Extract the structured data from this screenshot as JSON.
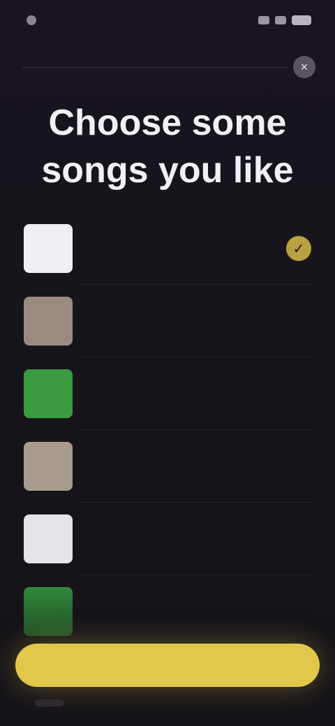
{
  "status_bar": {
    "time": "",
    "icons": [
      "signal-icon",
      "wifi-icon",
      "battery-icon"
    ]
  },
  "header": {
    "close_icon": "close-icon",
    "close_glyph": "×"
  },
  "title": "Choose some songs you like",
  "songs": [
    {
      "title": "",
      "artist": "",
      "thumb_color": "#f0eef2",
      "selected": true
    },
    {
      "title": "",
      "artist": "",
      "thumb_color": "#9a8a80",
      "selected": false
    },
    {
      "title": "",
      "artist": "",
      "thumb_color": "#3a9a3e",
      "selected": false
    },
    {
      "title": "",
      "artist": "",
      "thumb_color": "#a89a8c",
      "selected": false
    },
    {
      "title": "",
      "artist": "",
      "thumb_color": "#e6e4ea",
      "selected": false
    },
    {
      "title": "",
      "artist": "",
      "thumb_color": "#2f8a3a",
      "selected": false
    }
  ],
  "check_glyph": "✓",
  "cta": {
    "label": ""
  },
  "colors": {
    "accent": "#e2c84a",
    "background": "#151318"
  }
}
